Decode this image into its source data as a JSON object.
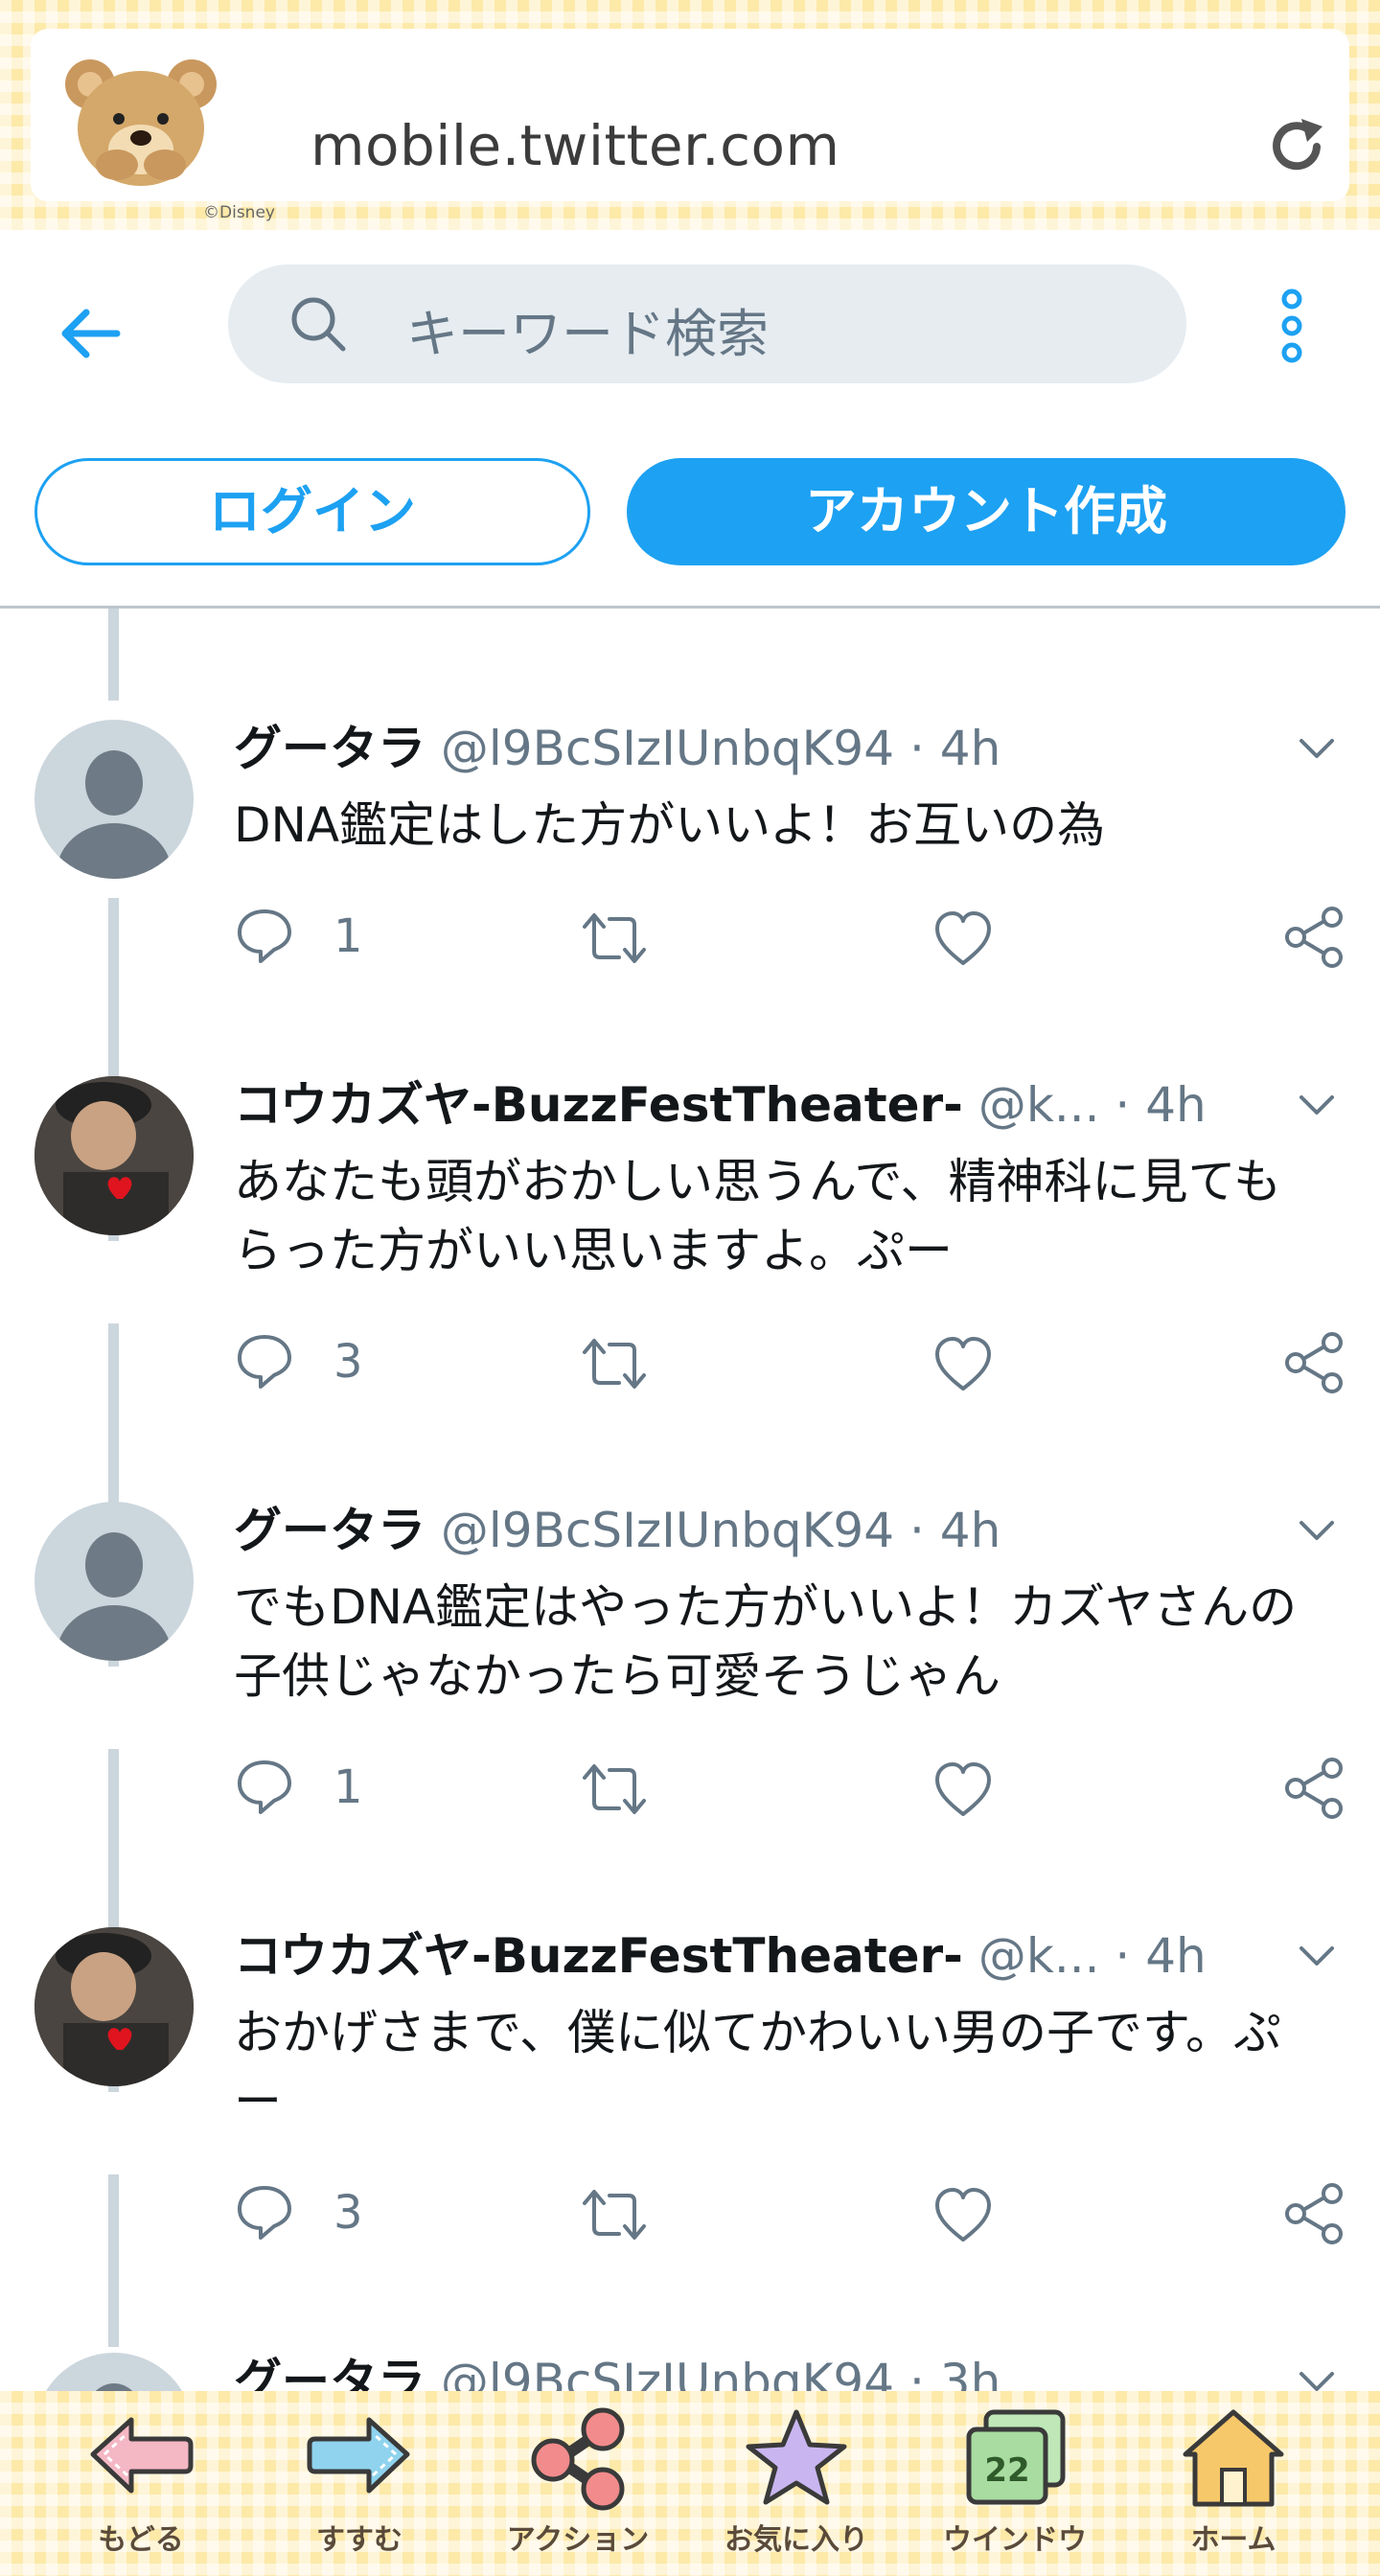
{
  "browser": {
    "url": "mobile.twitter.com",
    "disney_mark": "©Disney"
  },
  "header": {
    "search_placeholder": "キーワード検索",
    "login_label": "ログイン",
    "signup_label": "アカウント作成"
  },
  "tweets": [
    {
      "name": "グータラ",
      "handle": "@l9BcSIzIUnbqK94",
      "time": "4h",
      "text": "DNA鑑定はした方がいいよ！お互いの為",
      "reply_count": "1",
      "avatar": "default-avatar"
    },
    {
      "name": "コウカズヤ-BuzzFestTheater-",
      "handle": "@k...",
      "time": "4h",
      "text": "あなたも頭がおかしい思うんで、精神科に見てもらった方がいい思いますよ。ぷー",
      "reply_count": "3",
      "avatar": "photo-avatar"
    },
    {
      "name": "グータラ",
      "handle": "@l9BcSIzIUnbqK94",
      "time": "4h",
      "text": "でもDNA鑑定はやった方がいいよ！カズヤさんの子供じゃなかったら可愛そうじゃん",
      "reply_count": "1",
      "avatar": "default-avatar"
    },
    {
      "name": "コウカズヤ-BuzzFestTheater-",
      "handle": "@k...",
      "time": "4h",
      "text": "おかげさまで、僕に似てかわいい男の子です。ぷー",
      "reply_count": "3",
      "avatar": "photo-avatar"
    },
    {
      "name": "グータラ",
      "handle": "@l9BcSIzIUnbqK94",
      "time": "3h",
      "text": "",
      "reply_count": "",
      "avatar": "default-avatar"
    }
  ],
  "toolbar": {
    "back": "もどる",
    "forward": "すすむ",
    "action": "アクション",
    "favorites": "お気に入り",
    "window": "ウインドウ",
    "window_count": "22",
    "home": "ホーム"
  },
  "colors": {
    "twitter_blue": "#1da1f2",
    "muted_text": "#657786",
    "gingham": "#fde9a8"
  },
  "icons": [
    "bear-mascot-icon",
    "reload-icon",
    "back-arrow-icon",
    "search-icon",
    "more-icon",
    "reply-icon",
    "retweet-icon",
    "like-icon",
    "share-icon",
    "chevron-down-icon"
  ]
}
